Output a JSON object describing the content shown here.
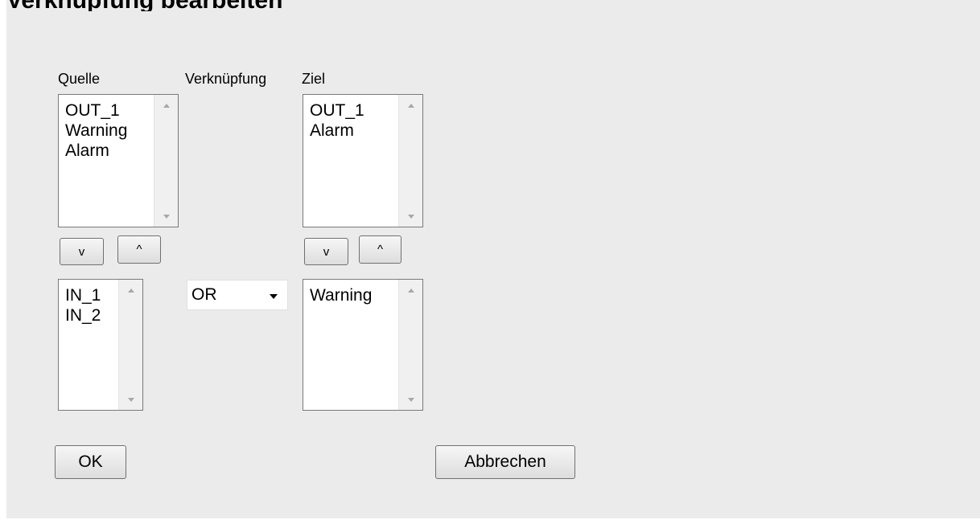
{
  "dialog": {
    "title": "Verknüpfung bearbeiten"
  },
  "labels": {
    "source": "Quelle",
    "link": "Verknüpfung",
    "target": "Ziel"
  },
  "source_list": {
    "items": [
      "OUT_1",
      "Warning",
      "Alarm"
    ]
  },
  "source_buttons": {
    "down": "v",
    "up": "^"
  },
  "input_list": {
    "items": [
      "IN_1",
      "IN_2"
    ]
  },
  "link_select": {
    "value": "OR"
  },
  "target_list": {
    "items": [
      "OUT_1",
      "Alarm"
    ]
  },
  "target_buttons": {
    "down": "v",
    "up": "^"
  },
  "target_input_list": {
    "items": [
      "Warning"
    ]
  },
  "footer": {
    "ok_label": "OK",
    "cancel_label": "Abbrechen"
  }
}
